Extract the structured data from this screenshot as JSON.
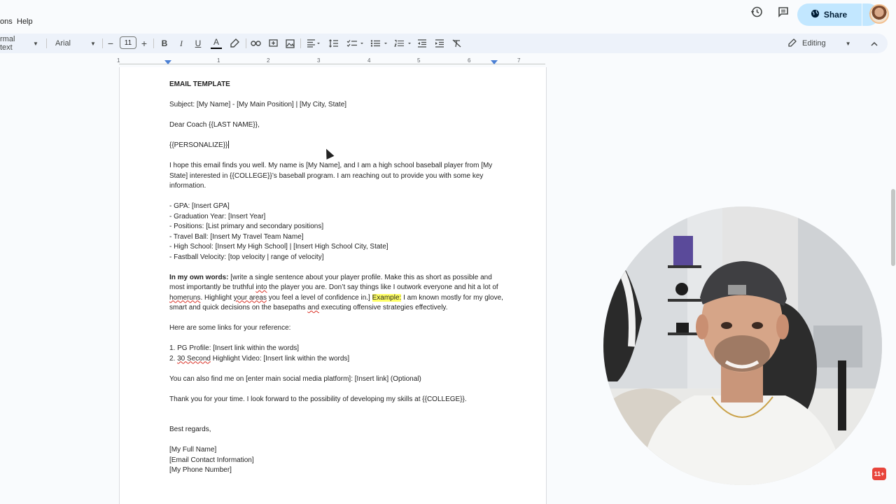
{
  "menubar": {
    "items": [
      "ons",
      "Help"
    ]
  },
  "header": {
    "share_label": "Share"
  },
  "toolbar": {
    "style_value": "rmal text",
    "font_value": "Arial",
    "font_size": "11",
    "bold": "B",
    "italic": "I",
    "underline": "U",
    "text_color": "A",
    "mode_label": "Editing"
  },
  "ruler": {
    "numbers": [
      "1",
      "1",
      "2",
      "3",
      "4",
      "5",
      "6",
      "7"
    ]
  },
  "document": {
    "title": "EMAIL TEMPLATE",
    "subject": "Subject: [My Name] - [My Main Position] | [My City, State]",
    "greeting": "Dear Coach {{LAST NAME}},",
    "personalize": "{{PERSONALIZE}}",
    "intro": "I hope this email finds you well. My name is [My Name], and I am a high school baseball player from [My State] interested in {{COLLEGE}}’s baseball program. I am reaching out to provide you with some key information.",
    "info_items": [
      "- GPA: [Insert GPA]",
      "- Graduation Year: [Insert Year]",
      "- Positions: [List primary and secondary positions]",
      "- Travel Ball: [Insert My Travel Team Name]",
      "- High School: [Insert My High School] | [Insert High School City, State]",
      "- Fastball Velocity: [top velocity | range of velocity]"
    ],
    "own_words_label": "In my own words:",
    "own_words_text_1": " [write a single sentence about your player profile. Make this as short as possible and most importantly be truthful ",
    "own_words_into": "into",
    "own_words_text_2": " the player you are. Don’t say things like I outwork everyone and hit a lot of ",
    "own_words_homeruns": "homeruns",
    "own_words_text_3": ". Highlight ",
    "own_words_your_areas": "your areas",
    "own_words_text_4": " you feel a level of confidence in.]",
    "example_label": "Example:",
    "example_text_1": " I am known mostly for my glove, smart and quick decisions on the basepaths ",
    "example_and": "and",
    "example_text_2": " executing offensive strategies effectively.",
    "links_intro": "Here are some links for your reference:",
    "link_1": "1. PG Profile: [Insert link within the words]",
    "link_2_prefix": "2. ",
    "link_2_squig": "30 Second",
    "link_2_rest": " Highlight Video: [Insert link within the words]",
    "social": "You can also find me on [enter main social media platform]: [Insert link] (Optional)",
    "thanks": "Thank you for your time. I look forward to the possibility of developing my skills at {{COLLEGE}}.",
    "closing": "Best regards,",
    "sig_name": "[My Full Name]",
    "sig_email": "[Email Contact Information]",
    "sig_phone": "[My Phone Number]"
  },
  "badge": {
    "label": "11+"
  },
  "colors": {
    "share_bg": "#c2e7ff",
    "toolbar_bg": "#edf2fa",
    "highlight": "#ffff66",
    "spell_error": "#d93025"
  }
}
